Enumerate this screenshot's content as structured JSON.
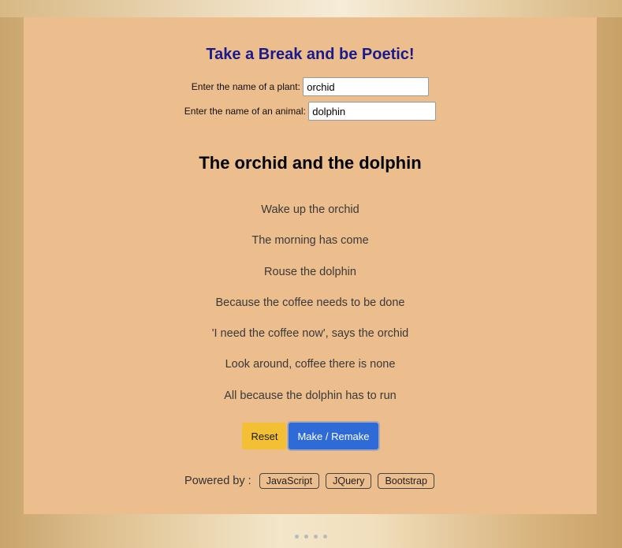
{
  "header": {
    "title": "Take a Break and be Poetic!"
  },
  "form": {
    "plant_label": "Enter the name of a plant:",
    "plant_value": "orchid",
    "animal_label": "Enter the name of an animal:",
    "animal_value": "dolphin"
  },
  "poem": {
    "title": "The orchid and the dolphin",
    "lines": [
      "Wake up the orchid",
      "The morning has come",
      "Rouse the dolphin",
      "Because the coffee needs to be done",
      "'I need the coffee now', says the orchid",
      "Look around, coffee there is none",
      "All because the dolphin has to run"
    ]
  },
  "buttons": {
    "reset_label": "Reset",
    "make_label": "Make / Remake"
  },
  "footer": {
    "powered_label": "Powered by :",
    "tags": [
      "JavaScript",
      "JQuery",
      "Bootstrap"
    ]
  },
  "colors": {
    "card_background": "#ecbd8d",
    "title_color": "#1a1a8c",
    "reset_button": "#f4c033",
    "make_button": "#2e6bd6"
  }
}
